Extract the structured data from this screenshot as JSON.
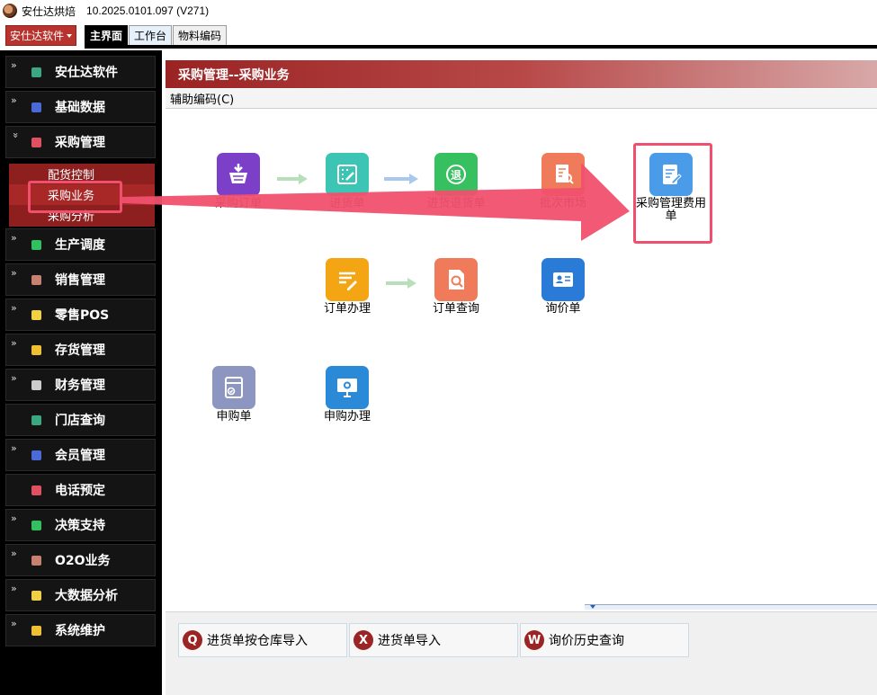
{
  "window": {
    "title": "安仕达烘焙",
    "version": "10.2025.0101.097 (V271)"
  },
  "toolbar": {
    "brand_label": "安仕达软件",
    "tabs": [
      {
        "label": "主界面"
      },
      {
        "label": "工作台"
      },
      {
        "label": "物料编码"
      }
    ]
  },
  "sidebar": {
    "items": [
      {
        "label": "安仕达软件",
        "color": "#3aa880"
      },
      {
        "label": "基础数据",
        "color": "#4a6ad8"
      },
      {
        "label": "采购管理",
        "color": "#e05060"
      },
      {
        "label": "生产调度",
        "color": "#30c060"
      },
      {
        "label": "销售管理",
        "color": "#c88070"
      },
      {
        "label": "零售POS",
        "color": "#f0d040"
      },
      {
        "label": "存货管理",
        "color": "#f0c030"
      },
      {
        "label": "财务管理",
        "color": "#cccccc"
      },
      {
        "label": "门店查询",
        "color": "#3aa880"
      },
      {
        "label": "会员管理",
        "color": "#4a6ad8"
      },
      {
        "label": "电话预定",
        "color": "#e05060"
      },
      {
        "label": "决策支持",
        "color": "#30c060"
      },
      {
        "label": "O2O业务",
        "color": "#c88070"
      },
      {
        "label": "大数据分析",
        "color": "#f0d040"
      },
      {
        "label": "系统维护",
        "color": "#f0c030"
      }
    ],
    "submenu": [
      {
        "label": "配货控制"
      },
      {
        "label": "采购业务"
      },
      {
        "label": "采购分析"
      }
    ]
  },
  "main": {
    "header_title": "采购管理--采购业务",
    "assist_label": "辅助编码(C)",
    "functions": [
      {
        "label": "采购订单",
        "icon": "basket-icon",
        "color": "#7b3fc8"
      },
      {
        "label": "进货单",
        "icon": "edit-grid-icon",
        "color": "#3cc5b4"
      },
      {
        "label": "进货退货单",
        "icon": "return-icon",
        "color": "#36c060"
      },
      {
        "label": "批次市场",
        "icon": "document-search-icon",
        "color": "#ef7b5a"
      },
      {
        "label": "采购管理费用单",
        "icon": "note-pen-icon",
        "color": "#4a9ce8"
      },
      {
        "label": "订单办理",
        "icon": "list-pen-icon",
        "color": "#f4a514"
      },
      {
        "label": "订单查询",
        "icon": "file-search-icon",
        "color": "#ef7b5a"
      },
      {
        "label": "询价单",
        "icon": "id-card-icon",
        "color": "#2a7ad8"
      },
      {
        "label": "申购单",
        "icon": "form-check-icon",
        "color": "#8c96c0"
      },
      {
        "label": "申购办理",
        "icon": "monitor-gear-icon",
        "color": "#2a8ad8"
      }
    ]
  },
  "bottom": {
    "buttons": [
      {
        "label": "进货单按仓库导入",
        "icon": "search-circle-icon",
        "glyph": "Q"
      },
      {
        "label": "进货单导入",
        "icon": "x-circle-icon",
        "glyph": "X"
      },
      {
        "label": "询价历史查询",
        "icon": "w-circle-icon",
        "glyph": "W"
      }
    ]
  }
}
